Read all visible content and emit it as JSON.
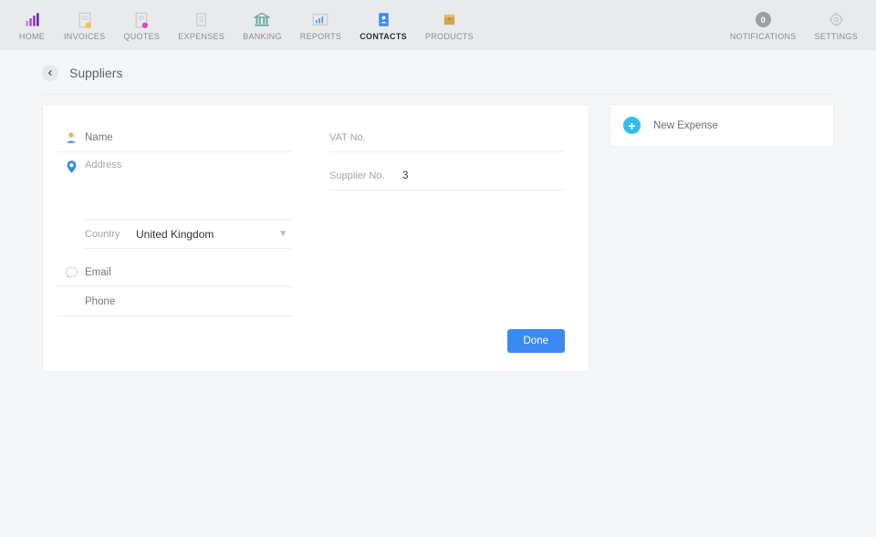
{
  "nav": {
    "home": "HOME",
    "invoices": "INVOICES",
    "quotes": "QUOTES",
    "expenses": "EXPENSES",
    "banking": "BANKING",
    "reports": "REPORTS",
    "contacts": "CONTACTS",
    "products": "PRODUCTS",
    "notifications": "NOTIFICATIONS",
    "notifications_count": "0",
    "settings": "SETTINGS"
  },
  "page": {
    "title": "Suppliers"
  },
  "form": {
    "name_label": "Name",
    "name_value": "",
    "address_label": "Address",
    "address_value": "",
    "country_label": "Country",
    "country_value": "United Kingdom",
    "email_label": "Email",
    "email_value": "",
    "phone_label": "Phone",
    "phone_value": "",
    "vat_label": "VAT No.",
    "vat_value": "",
    "supplier_no_label": "Supplier No.",
    "supplier_no_value": "3",
    "done_label": "Done"
  },
  "side": {
    "new_expense": "New Expense"
  }
}
